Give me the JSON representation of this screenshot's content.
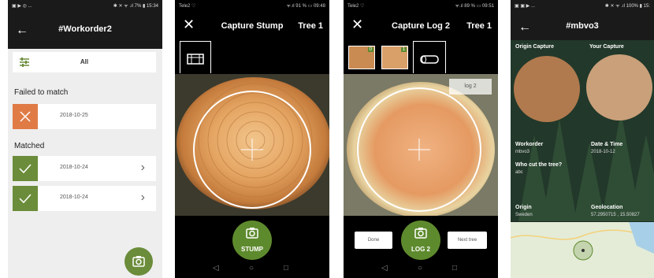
{
  "phone1": {
    "status_left": "▣ ▶ ◎ ...",
    "status_right": "✱ ✕ ᯤ .ıl 7% ▮ 15:34",
    "title": "#Workorder2",
    "filter_label": "All",
    "section_failed": "Failed to match",
    "section_matched": "Matched",
    "rows": [
      {
        "date": "2018-10-25",
        "status": "failed"
      },
      {
        "date": "2018-10-24",
        "status": "matched"
      },
      {
        "date": "2018-10-24",
        "status": "matched"
      }
    ],
    "colors": {
      "failed": "#e07b46",
      "matched": "#6b8c3a"
    }
  },
  "phone2": {
    "status_left": "Tele2 ♡",
    "status_right": "ᯤ.ıl 91 % ▭ 09:48",
    "title": "Capture Stump",
    "tree": "Tree 1",
    "capture_label": "STUMP"
  },
  "phone3": {
    "status_left": "Tele2 ♡",
    "status_right": "ᯤ.ıl 89 % ▭ 09:51",
    "title": "Capture Log 2",
    "tree": "Tree 1",
    "thumb_counts": [
      "0",
      "1"
    ],
    "log_tag": "log 2",
    "done_label": "Done",
    "next_label": "Next tree",
    "capture_label": "LOG 2"
  },
  "phone4": {
    "status_left": "▣ ▣ ▶ ...",
    "status_right": "✱ ✕ ᯤ .ıl 100% ▮ 15:",
    "title": "#mbvo3",
    "origin_capture": "Origin Capture",
    "your_capture": "Your Capture",
    "workorder_label": "Workorder",
    "workorder_value": "mbvo3",
    "date_label": "Date & Time",
    "date_value": "2018-10-12",
    "who_label": "Who cut the tree?",
    "who_value": "abc",
    "origin_label": "Origin",
    "origin_value": "Sweden",
    "geo_label": "Geolocation",
    "geo_value": "57.2950715 , 15.50827"
  }
}
